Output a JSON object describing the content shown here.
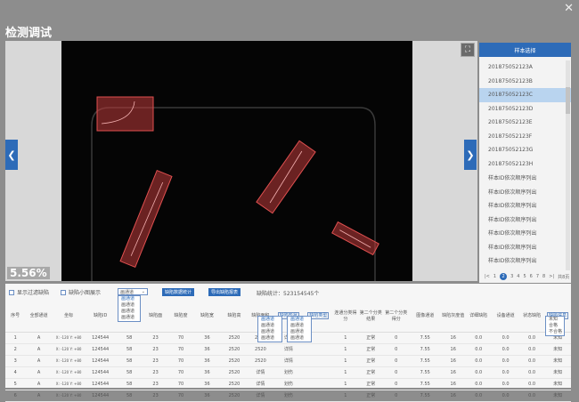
{
  "window": {
    "title": "检测调试",
    "close_glyph": "✕"
  },
  "viewer": {
    "zoom_text": "5.56%",
    "fit_icon": "⛶",
    "prev_glyph": "❮",
    "next_glyph": "❯"
  },
  "sample_panel": {
    "header": "样本选择",
    "items": [
      "201875052123A",
      "201875052123B",
      "201875052123C",
      "201875052123D",
      "201875052123E",
      "201875052123F",
      "201875052123G",
      "201875052123H",
      "样本ID依次顺序列出",
      "样本ID依次顺序列出",
      "样本ID依次顺序列出",
      "样本ID依次顺序列出",
      "样本ID依次顺序列出",
      "样本ID依次顺序列出",
      "样本ID依次顺序列出"
    ],
    "selected_index": 2,
    "pager": [
      "|<",
      "1",
      "2",
      "3",
      "4",
      "5",
      "6",
      "7",
      "8",
      ">|",
      "共8页"
    ]
  },
  "controls": {
    "show_filtered_label": "显示过滤缺陷",
    "show_thumb_label": "缺陷小图展示",
    "channel_select_value": "画通道",
    "channel_options": [
      "画通道",
      "画通道",
      "画通道",
      "画通道"
    ],
    "defect_stats_button": "缺陷数据统计",
    "export_button": "导出缺陷报表",
    "defect_count_label": "缺陷统计：",
    "defect_count_value": "523154545个"
  },
  "table": {
    "headers": [
      "序号",
      "全部通道",
      "坐标",
      "缺陷ID",
      "缺陷面",
      "缺陷面",
      "缺陷度",
      "缺陷宽",
      "缺陷高",
      "缺陷面积",
      "缺陷形状",
      "缺陷类型",
      "连通分类得分",
      "第二个分类结果",
      "第二个分类得分",
      "图像通道",
      "缺陷灰度值",
      "详细缺陷",
      "设备通道",
      "状态缺陷",
      "缺陷信息"
    ],
    "sort_dropdown_a": [
      "画通道",
      "画通道",
      "画通道",
      "画通道"
    ],
    "sort_dropdown_b": [
      "画通道",
      "画通道",
      "画通道",
      "画通道"
    ],
    "status_dropdown": [
      "未知",
      "合格",
      "不合格"
    ],
    "rows": [
      [
        "1",
        "A",
        "X: -120 Y: +80",
        "124544",
        "58",
        "23",
        "70",
        "36",
        "2520",
        "2520",
        "详情",
        "",
        "1",
        "正常",
        "0",
        "7.55",
        "16",
        "0.0",
        "0.0",
        "0.0",
        "未知"
      ],
      [
        "2",
        "A",
        "X: -120 Y: +80",
        "124544",
        "58",
        "23",
        "70",
        "36",
        "2520",
        "2520",
        "详情",
        "",
        "1",
        "正常",
        "0",
        "7.55",
        "16",
        "0.0",
        "0.0",
        "0.0",
        "未知"
      ],
      [
        "3",
        "A",
        "X: -120 Y: +80",
        "124544",
        "58",
        "23",
        "70",
        "36",
        "2520",
        "2520",
        "详情",
        "",
        "1",
        "正常",
        "0",
        "7.55",
        "16",
        "0.0",
        "0.0",
        "0.0",
        "未知"
      ],
      [
        "4",
        "A",
        "X: -120 Y: +80",
        "124544",
        "58",
        "23",
        "70",
        "36",
        "2520",
        "详情",
        "划伤",
        "",
        "1",
        "正常",
        "0",
        "7.55",
        "16",
        "0.0",
        "0.0",
        "0.0",
        "未知"
      ],
      [
        "5",
        "A",
        "X: -120 Y: +80",
        "124544",
        "58",
        "23",
        "70",
        "36",
        "2520",
        "详情",
        "划伤",
        "",
        "1",
        "正常",
        "0",
        "7.55",
        "16",
        "0.0",
        "0.0",
        "0.0",
        "未知"
      ],
      [
        "6",
        "A",
        "X: -120 Y: +80",
        "124544",
        "58",
        "23",
        "70",
        "36",
        "2520",
        "详情",
        "划伤",
        "",
        "1",
        "正常",
        "0",
        "7.55",
        "16",
        "0.0",
        "0.0",
        "0.0",
        "未知"
      ]
    ]
  },
  "colors": {
    "accent": "#2d6bb8",
    "defect_box": "#c03a3a"
  }
}
